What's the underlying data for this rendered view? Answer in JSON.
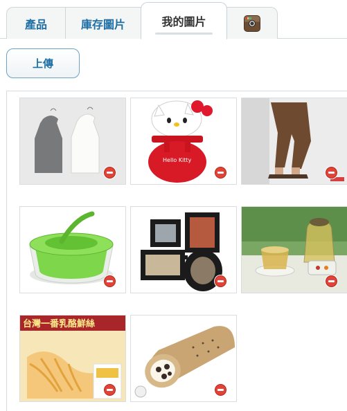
{
  "tabs": [
    {
      "label": "產品"
    },
    {
      "label": "庫存圖片"
    },
    {
      "label": "我的圖片",
      "active": true
    },
    {
      "label": "",
      "icon": "instagram-icon"
    }
  ],
  "upload_label": "上傳",
  "images": [
    {
      "name": "sleeveless-tops-photo"
    },
    {
      "name": "hello-kitty-fan-photo",
      "text": "Hello Kitty"
    },
    {
      "name": "capri-pants-photo"
    },
    {
      "name": "salad-spinner-photo"
    },
    {
      "name": "photo-frames-photo"
    },
    {
      "name": "tea-set-photo"
    },
    {
      "name": "squid-snack-photo",
      "text": "台灣一番乳酪鮮絲"
    },
    {
      "name": "swiss-roll-photo"
    }
  ],
  "colors": {
    "accent": "#1d6fa6",
    "remove": "#e04438"
  }
}
